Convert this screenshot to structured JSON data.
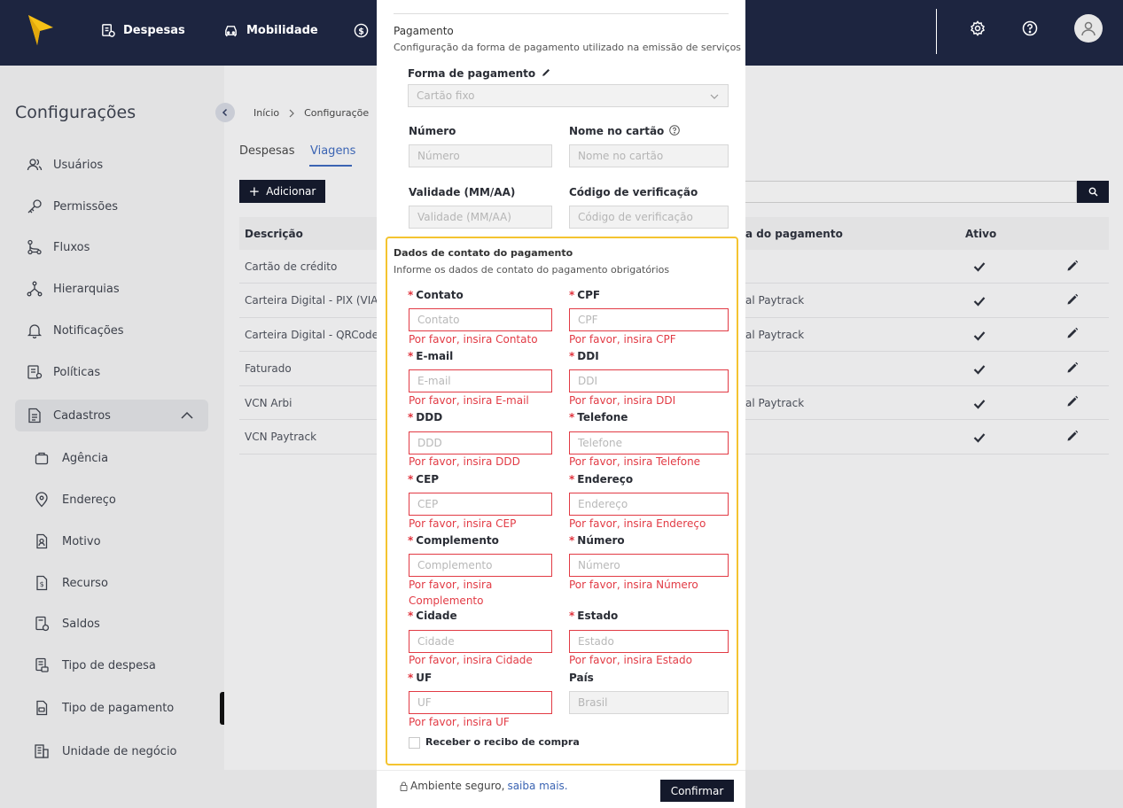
{
  "topbar": {
    "nav": [
      {
        "label": "Despesas",
        "icon": "receipt-icon"
      },
      {
        "label": "Mobilidade",
        "icon": "car-icon"
      },
      {
        "label": "",
        "icon": "dollar-icon"
      }
    ],
    "icons": [
      "gear-icon",
      "help-icon",
      "avatar"
    ],
    "colors": {
      "bar": "#1d2540",
      "logo": "#f7c116"
    }
  },
  "sidebar": {
    "title": "Configurações",
    "items": [
      {
        "label": "Usuários",
        "icon": "users-icon"
      },
      {
        "label": "Permissões",
        "icon": "key-icon"
      },
      {
        "label": "Fluxos",
        "icon": "flow-icon"
      },
      {
        "label": "Hierarquias",
        "icon": "hierarchy-icon"
      },
      {
        "label": "Notificações",
        "icon": "bell-icon"
      },
      {
        "label": "Políticas",
        "icon": "policy-icon"
      },
      {
        "label": "Cadastros",
        "icon": "document-icon"
      }
    ],
    "subitems": [
      {
        "label": "Agência",
        "icon": "bag-icon"
      },
      {
        "label": "Endereço",
        "icon": "pin-icon"
      },
      {
        "label": "Motivo",
        "icon": "file-person-icon"
      },
      {
        "label": "Recurso",
        "icon": "file-dollar-icon"
      },
      {
        "label": "Saldos",
        "icon": "calculator-icon"
      },
      {
        "label": "Tipo de despesa",
        "icon": "receipt-icon"
      },
      {
        "label": "Tipo de pagamento",
        "icon": "file-card-icon"
      },
      {
        "label": "Unidade de negócio",
        "icon": "building-icon"
      }
    ]
  },
  "main": {
    "breadcrumb": [
      "Início",
      "Configuraçõe"
    ],
    "tabs": [
      "Despesas",
      "Viagens"
    ],
    "active_tab": "Viagens",
    "add_label": "Adicionar",
    "table": {
      "headers": [
        "Descrição",
        "a do pagamento",
        "Ativo"
      ],
      "rows": [
        {
          "desc": "Cartão de crédito",
          "origin": "",
          "active": true
        },
        {
          "desc": "Carteira Digital - PIX (VIAG",
          "origin": "al Paytrack",
          "active": true
        },
        {
          "desc": "Carteira Digital - QRCode (",
          "origin": "al Paytrack",
          "active": true
        },
        {
          "desc": "Faturado",
          "origin": "",
          "active": true
        },
        {
          "desc": "VCN Arbi",
          "origin": "al Paytrack",
          "active": true
        },
        {
          "desc": "VCN Paytrack",
          "origin": "",
          "active": true
        }
      ]
    }
  },
  "modal": {
    "payment": {
      "title": "Pagamento",
      "subtitle": "Configuração da forma de pagamento utilizado na emissão de serviços",
      "method_label": "Forma de pagamento",
      "method_value": "Cartão fixo",
      "number_label": "Número",
      "number_placeholder": "Número",
      "name_label": "Nome no cartão",
      "name_placeholder": "Nome no cartão",
      "validity_label": "Validade (MM/AA)",
      "validity_placeholder": "Validade (MM/AA)",
      "cvv_label": "Código de verificação",
      "cvv_placeholder": "Código de verificação"
    },
    "contact": {
      "title": "Dados de contato do pagamento",
      "subtitle": "Informe os dados de contato do pagamento obrigatórios",
      "fields": {
        "contato": {
          "label": "Contato",
          "placeholder": "Contato",
          "error": "Por favor, insira Contato"
        },
        "cpf": {
          "label": "CPF",
          "placeholder": "CPF",
          "error": "Por favor, insira CPF"
        },
        "email": {
          "label": "E-mail",
          "placeholder": "E-mail",
          "error": "Por favor, insira E-mail"
        },
        "ddi": {
          "label": "DDI",
          "placeholder": "DDI",
          "error": "Por favor, insira DDI"
        },
        "ddd": {
          "label": "DDD",
          "placeholder": "DDD",
          "error": "Por favor, insira DDD"
        },
        "telefone": {
          "label": "Telefone",
          "placeholder": "Telefone",
          "error": "Por favor, insira Telefone"
        },
        "cep": {
          "label": "CEP",
          "placeholder": "CEP",
          "error": "Por favor, insira CEP"
        },
        "endereco": {
          "label": "Endereço",
          "placeholder": "Endereço",
          "error": "Por favor, insira Endereço"
        },
        "complemento": {
          "label": "Complemento",
          "placeholder": "Complemento",
          "error_line1": "Por favor, insira",
          "error_line2": "Complemento"
        },
        "numero": {
          "label": "Número",
          "placeholder": "Número",
          "error": "Por favor, insira Número"
        },
        "cidade": {
          "label": "Cidade",
          "placeholder": "Cidade",
          "error": "Por favor, insira Cidade"
        },
        "estado": {
          "label": "Estado",
          "placeholder": "Estado",
          "error": "Por favor, insira Estado"
        },
        "uf": {
          "label": "UF",
          "placeholder": "UF",
          "error": "Por favor, insira UF"
        },
        "pais": {
          "label": "País",
          "value": "Brasil"
        }
      },
      "receipt_checkbox": "Receber o recibo de compra",
      "receipt_checked": false
    },
    "footer": {
      "secure_text": "Ambiente seguro,",
      "secure_link": "saiba mais.",
      "confirm_label": "Confirmar"
    },
    "colors": {
      "highlight": "#f4c430",
      "error": "#e23b45",
      "link": "#3b64b3"
    }
  }
}
